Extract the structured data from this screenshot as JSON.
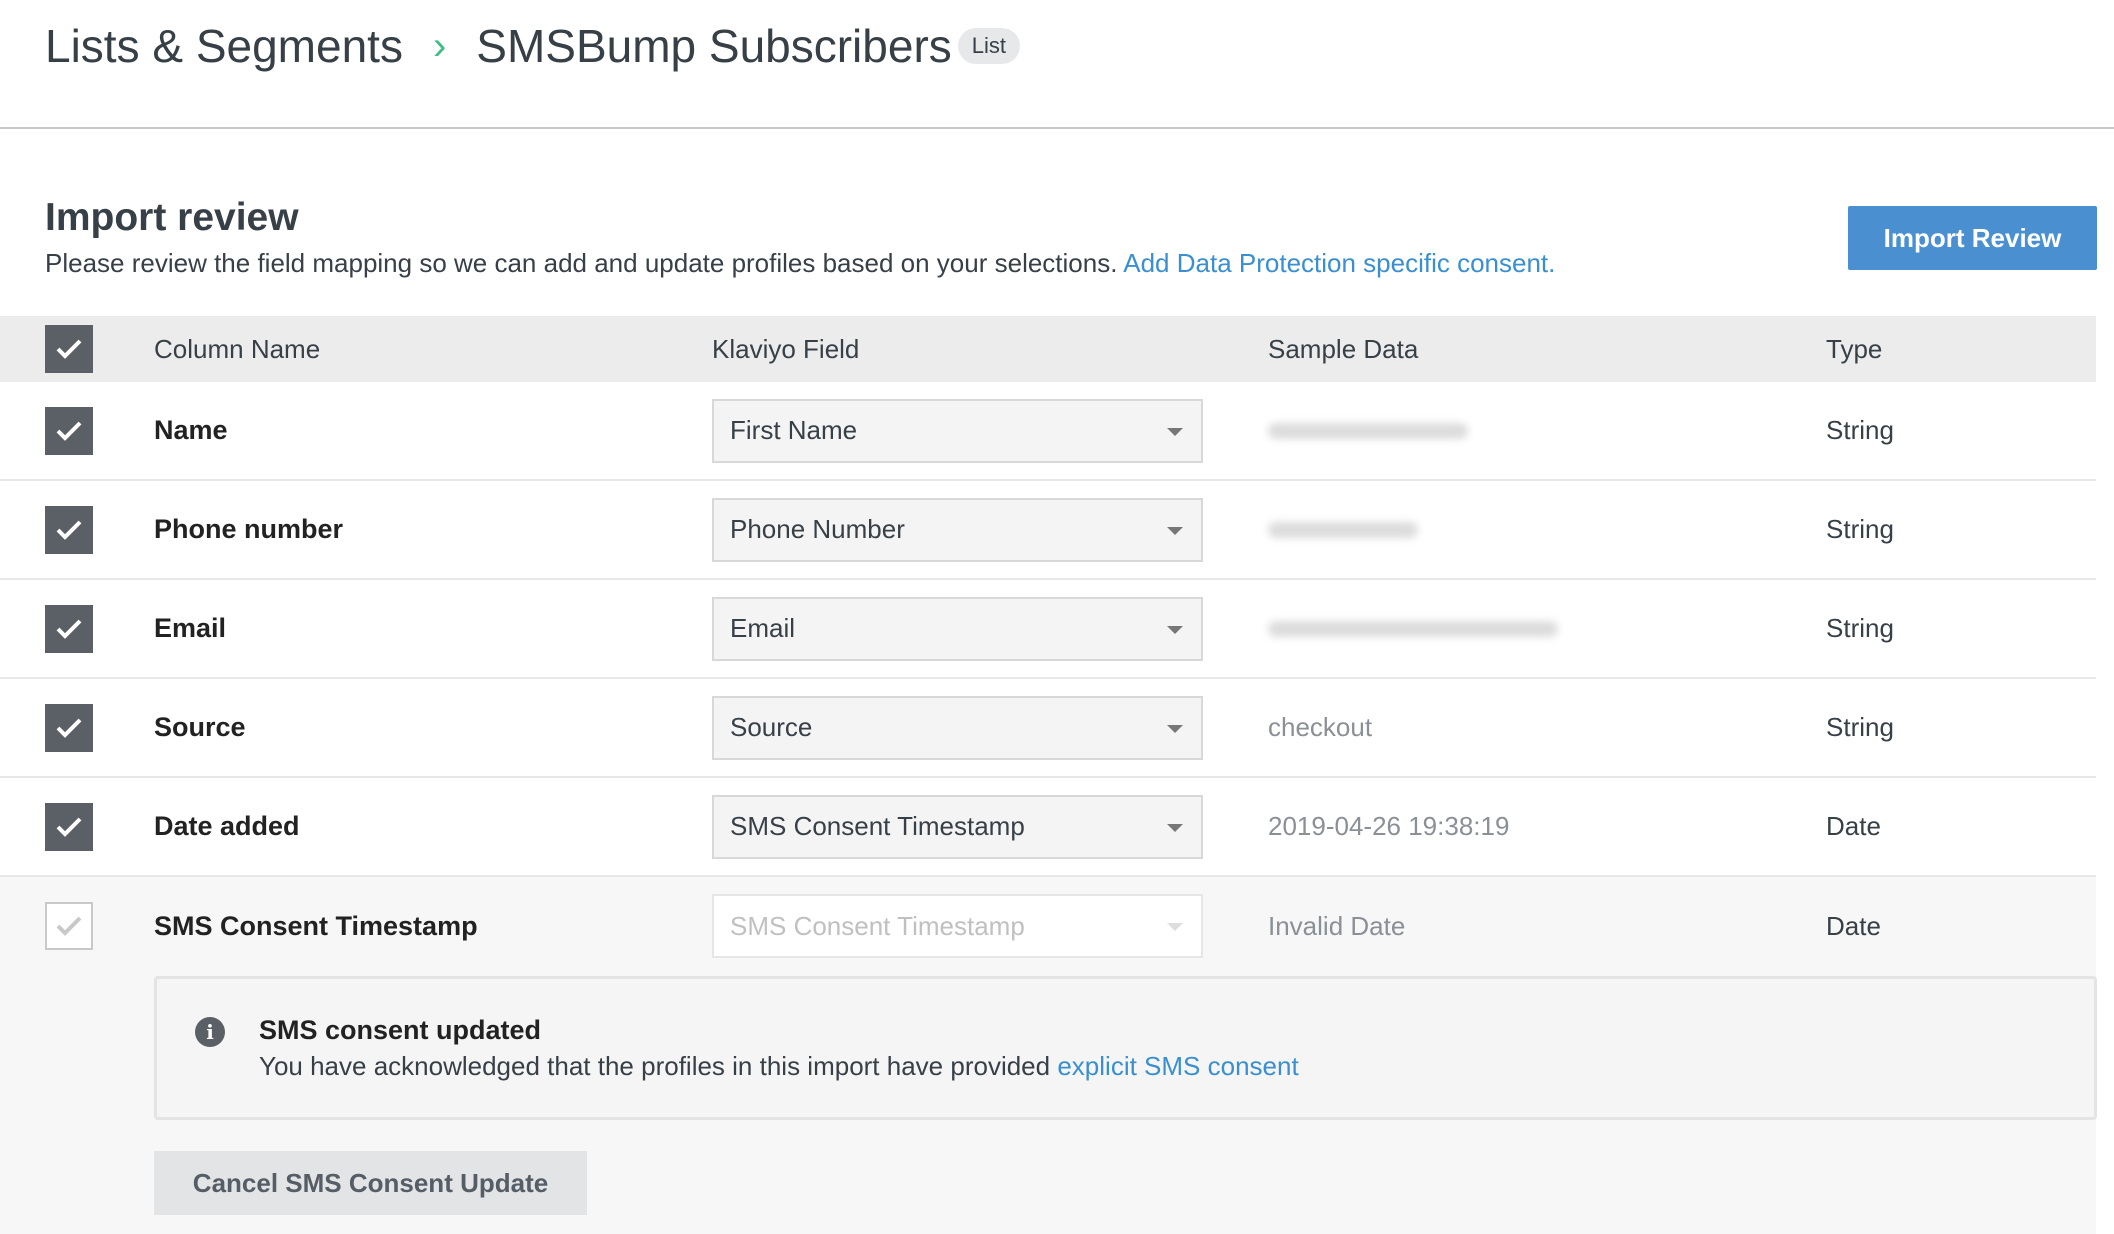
{
  "breadcrumb": {
    "parent": "Lists & Segments",
    "current": "SMSBump Subscribers",
    "badge": "List"
  },
  "section": {
    "title": "Import review",
    "description": "Please review the field mapping so we can add and update profiles based on your selections.",
    "link": "Add Data Protection specific consent.",
    "button": "Import Review"
  },
  "table": {
    "headers": {
      "column_name": "Column Name",
      "klaviyo_field": "Klaviyo Field",
      "sample_data": "Sample Data",
      "type": "Type"
    },
    "rows": [
      {
        "column": "Name",
        "field": "First Name",
        "sample": "",
        "sample_blurred": true,
        "type": "String",
        "checked": true
      },
      {
        "column": "Phone number",
        "field": "Phone Number",
        "sample": "",
        "sample_blurred": true,
        "type": "String",
        "checked": true
      },
      {
        "column": "Email",
        "field": "Email",
        "sample": "",
        "sample_blurred": true,
        "type": "String",
        "checked": true
      },
      {
        "column": "Source",
        "field": "Source",
        "sample": "checkout",
        "type": "String",
        "checked": true
      },
      {
        "column": "Date added",
        "field": "SMS Consent Timestamp",
        "sample": "2019-04-26 19:38:19",
        "type": "Date",
        "checked": true
      },
      {
        "column": "SMS Consent Timestamp",
        "field": "SMS Consent Timestamp",
        "sample": "Invalid Date",
        "type": "Date",
        "checked": false,
        "disabled": true
      }
    ]
  },
  "notice": {
    "title": "SMS consent updated",
    "text": "You have acknowledged that the profiles in this import have provided",
    "link": "explicit SMS consent",
    "icon": "info-icon"
  },
  "cancel_button": "Cancel SMS Consent Update",
  "colors": {
    "accent": "#4a90d0",
    "link": "#3a8fd0",
    "checkbox": "#5a6066",
    "breadcrumb_chevron": "#3fbf85"
  }
}
